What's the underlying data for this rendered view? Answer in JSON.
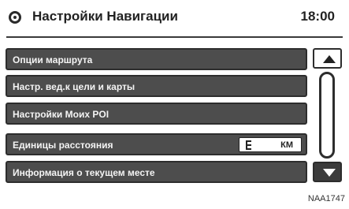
{
  "header": {
    "title": "Настройки Навигации",
    "time": "18:00"
  },
  "menu": [
    {
      "label": "Опции маршрута"
    },
    {
      "label": "Настр. вед.к цели и карты"
    },
    {
      "label": "Настройки Моих POI"
    },
    {
      "label": "Единицы расстояния",
      "value": "КМ"
    },
    {
      "label": "Информация о текущем месте"
    }
  ],
  "footer": {
    "code": "NAA1747"
  },
  "colors": {
    "item_bg": "#4d4d4d",
    "item_text": "#f4f4f4",
    "background": "#ffffff"
  }
}
